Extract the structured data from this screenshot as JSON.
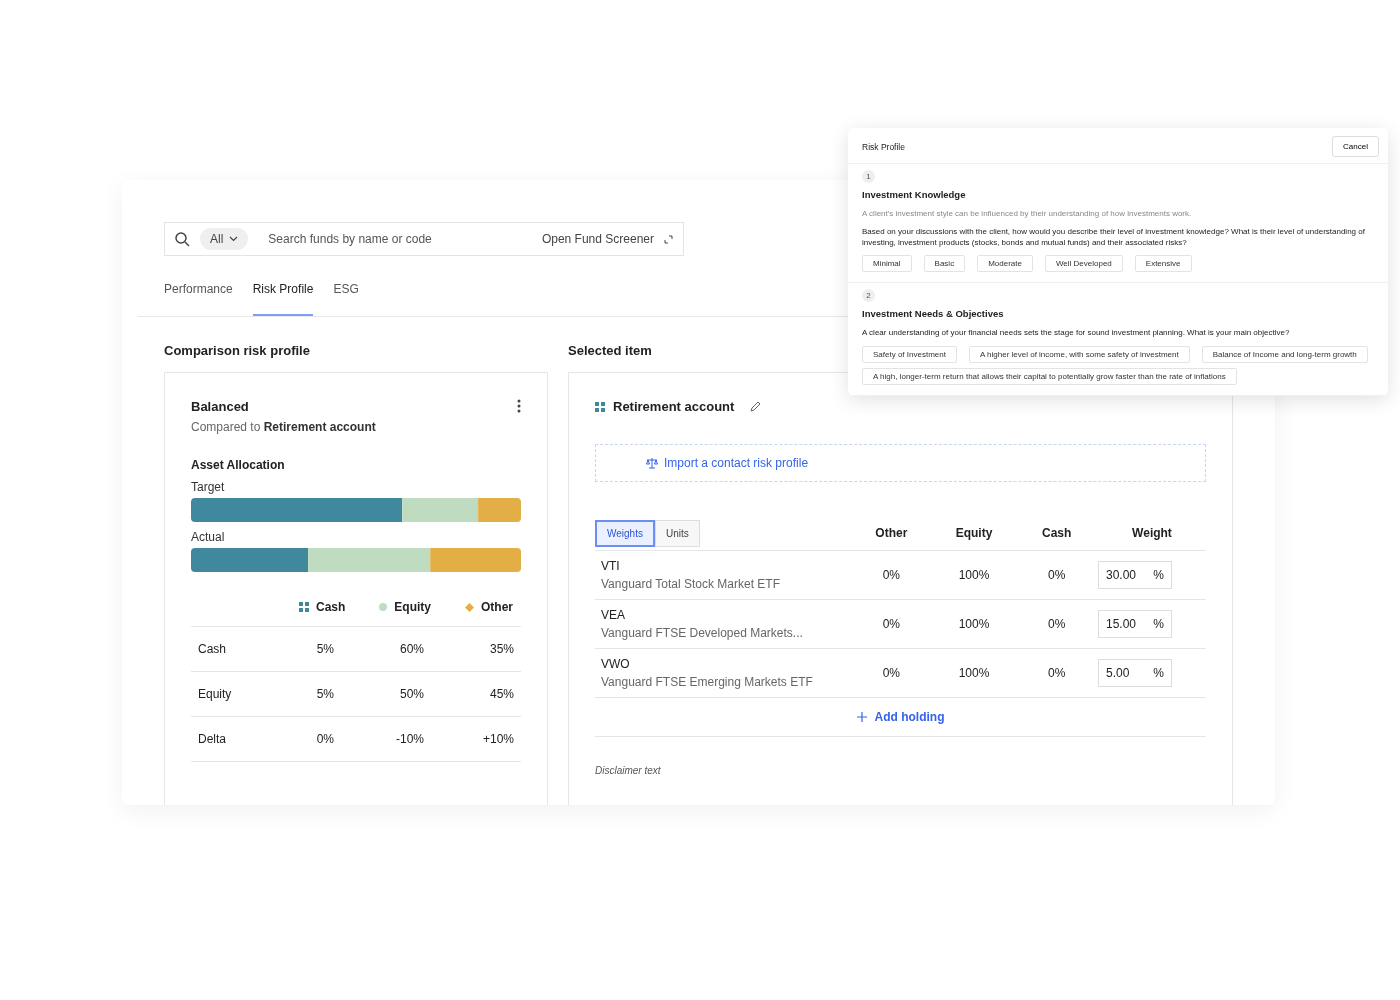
{
  "search": {
    "filter": "All",
    "placeholder": "Search funds by name or code",
    "screener_link": "Open Fund Screener"
  },
  "tabs": [
    {
      "label": "Performance",
      "selected": false
    },
    {
      "label": "Risk Profile",
      "selected": true
    },
    {
      "label": "ESG",
      "selected": false
    }
  ],
  "comparison": {
    "heading": "Comparison risk profile",
    "title": "Balanced",
    "subtitle": "Compared to **Retirement account**",
    "section": "Asset Allocation",
    "bars": [
      {
        "label": "Target"
      },
      {
        "label": "Actual"
      }
    ],
    "legend": [
      {
        "label": "Cash",
        "kind": "grid",
        "color": "#40889d"
      },
      {
        "label": "Equity",
        "kind": "dot",
        "color": "#c0dcc0"
      },
      {
        "label": "Other",
        "kind": "diamond",
        "color": "#e3ae46"
      }
    ],
    "rows": [
      {
        "label": "Cash",
        "values": [
          "5%",
          "60%",
          "35%"
        ]
      },
      {
        "label": "Equity",
        "values": [
          "5%",
          "50%",
          "45%"
        ]
      },
      {
        "label": "Delta",
        "values": [
          "0%",
          "-10%",
          "+10%"
        ]
      }
    ]
  },
  "selected_item": {
    "heading": "Selected item",
    "title": "Retirement account",
    "import_link": "Import a contact risk profile",
    "toggle": [
      {
        "label": "Weights",
        "selected": true
      },
      {
        "label": "Units",
        "selected": false
      }
    ],
    "columns": [
      "Other",
      "Equity",
      "Cash",
      "Weight"
    ],
    "holdings": [
      {
        "code": "VTI",
        "name": "Vanguard Total Stock Market ETF",
        "other": "0%",
        "equity": "100%",
        "cash": "0%",
        "weight": "30.00",
        "unit": "%"
      },
      {
        "code": "VEA",
        "name": "Vanguard FTSE Developed Markets...",
        "other": "0%",
        "equity": "100%",
        "cash": "0%",
        "weight": "15.00",
        "unit": "%"
      },
      {
        "code": "VWO",
        "name": "Vanguard FTSE Emerging Markets ETF",
        "other": "0%",
        "equity": "100%",
        "cash": "0%",
        "weight": "5.00",
        "unit": "%"
      }
    ],
    "add_button": "Add holding",
    "disclaimer": "Disclaimer text"
  },
  "modal": {
    "title": "Risk Profile",
    "cancel": "Cancel",
    "questions": [
      {
        "number": "1",
        "title": "Investment Knowledge",
        "hint": "A client's investment style can be influenced by their understanding of how investments work.",
        "prompt": "Based on your discussions with the client, how would you describe their level of investment knowledge? What is their level of understanding of investing, investment products (stocks, bonds and mutual funds) and their associated risks?",
        "options": [
          "Minimal",
          "Basic",
          "Moderate",
          "Well Developed",
          "Extensive"
        ]
      },
      {
        "number": "2",
        "title": "Investment Needs & Objectives",
        "prompt": "A clear understanding of your financial needs sets the stage for sound investment planning. What is your main objective?",
        "options": [
          "Safety of Investment",
          "A higher level of income, with some safety of investment",
          "Balance of Income and long-term growth",
          "A high, longer-term return that allows their capital to potentially grow faster than the rate of inflations"
        ]
      }
    ]
  }
}
